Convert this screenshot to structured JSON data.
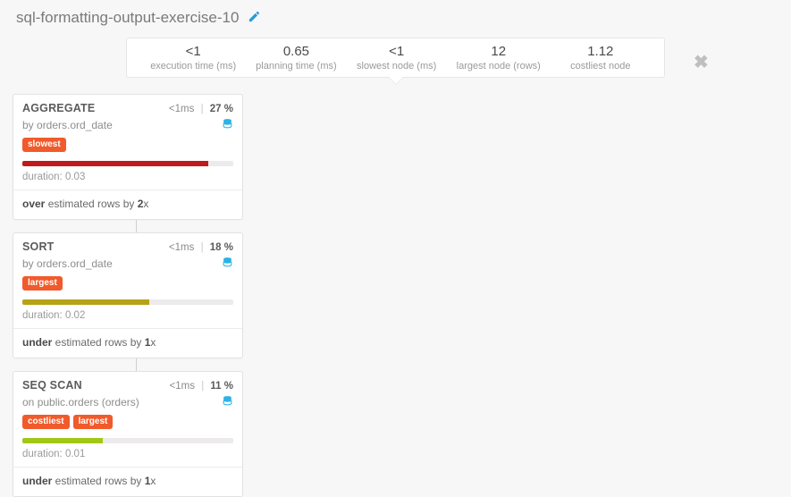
{
  "header": {
    "title": "sql-formatting-output-exercise-10"
  },
  "stats": {
    "execution_time": {
      "value": "<1",
      "label": "execution time (ms)"
    },
    "planning_time": {
      "value": "0.65",
      "label": "planning time (ms)"
    },
    "slowest_node": {
      "value": "<1",
      "label": "slowest node (ms)"
    },
    "largest_node": {
      "value": "12",
      "label": "largest node (rows)"
    },
    "costliest_node": {
      "value": "1.12",
      "label": "costliest node"
    }
  },
  "labels": {
    "duration_prefix": "duration: ",
    "by_prefix": "by ",
    "on_prefix": "on "
  },
  "nodes": [
    {
      "type": "AGGREGATE",
      "time": "<1ms",
      "pct": "27 %",
      "rel_prefix": "by ",
      "relation": "orders.ord_date",
      "tags": [
        "slowest"
      ],
      "bar_class": "bar-red",
      "bar_width": "88%",
      "duration": "0.03",
      "estimate_dir": "over",
      "estimate_mid": " estimated rows by ",
      "estimate_factor": "2",
      "estimate_suffix": "x"
    },
    {
      "type": "SORT",
      "time": "<1ms",
      "pct": "18 %",
      "rel_prefix": "by ",
      "relation": "orders.ord_date",
      "tags": [
        "largest"
      ],
      "bar_class": "bar-olive",
      "bar_width": "60%",
      "duration": "0.02",
      "estimate_dir": "under",
      "estimate_mid": " estimated rows by ",
      "estimate_factor": "1",
      "estimate_suffix": "x"
    },
    {
      "type": "SEQ SCAN",
      "time": "<1ms",
      "pct": "11 %",
      "rel_prefix": "on ",
      "relation": "public.orders (orders)",
      "tags": [
        "costliest",
        "largest"
      ],
      "bar_class": "bar-lime",
      "bar_width": "38%",
      "duration": "0.01",
      "estimate_dir": "under",
      "estimate_mid": " estimated rows by ",
      "estimate_factor": "1",
      "estimate_suffix": "x"
    }
  ]
}
